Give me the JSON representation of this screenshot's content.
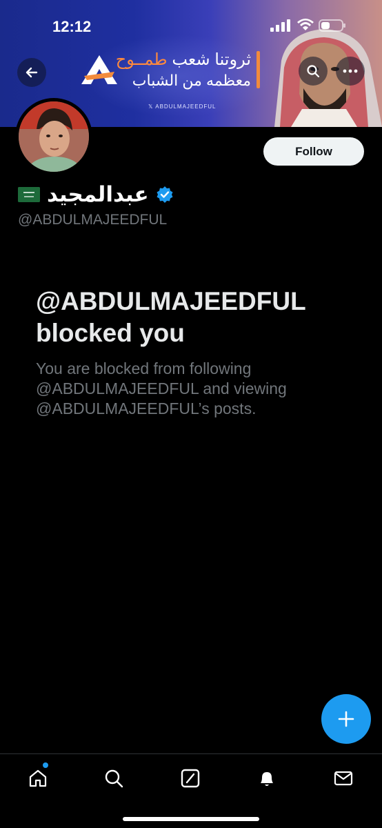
{
  "status_bar": {
    "time": "12:12"
  },
  "banner": {
    "line1_prefix": "ثروتنا شعب",
    "line1_accent": "طمــوح",
    "line2": "معظمه من الشباب",
    "handle": "𝕏 ABDULMAJEEDFUL",
    "accent_color": "#f28b3c"
  },
  "profile": {
    "display_name": "عبدالمجيد",
    "handle": "@ABDULMAJEEDFUL",
    "follow_label": "Follow",
    "verified": true,
    "flag": "🇸🇦"
  },
  "blocked": {
    "title": "@ABDULMAJEEDFUL blocked you",
    "description": "You are blocked from following @ABDULMAJEEDFUL and viewing @ABDULMAJEEDFUL’s posts."
  },
  "nav": {
    "items": [
      "home-icon",
      "search-icon",
      "grok-icon",
      "notifications-icon",
      "messages-icon"
    ]
  },
  "colors": {
    "accent": "#1d9bf0",
    "background": "#000000",
    "muted": "#71767b"
  }
}
